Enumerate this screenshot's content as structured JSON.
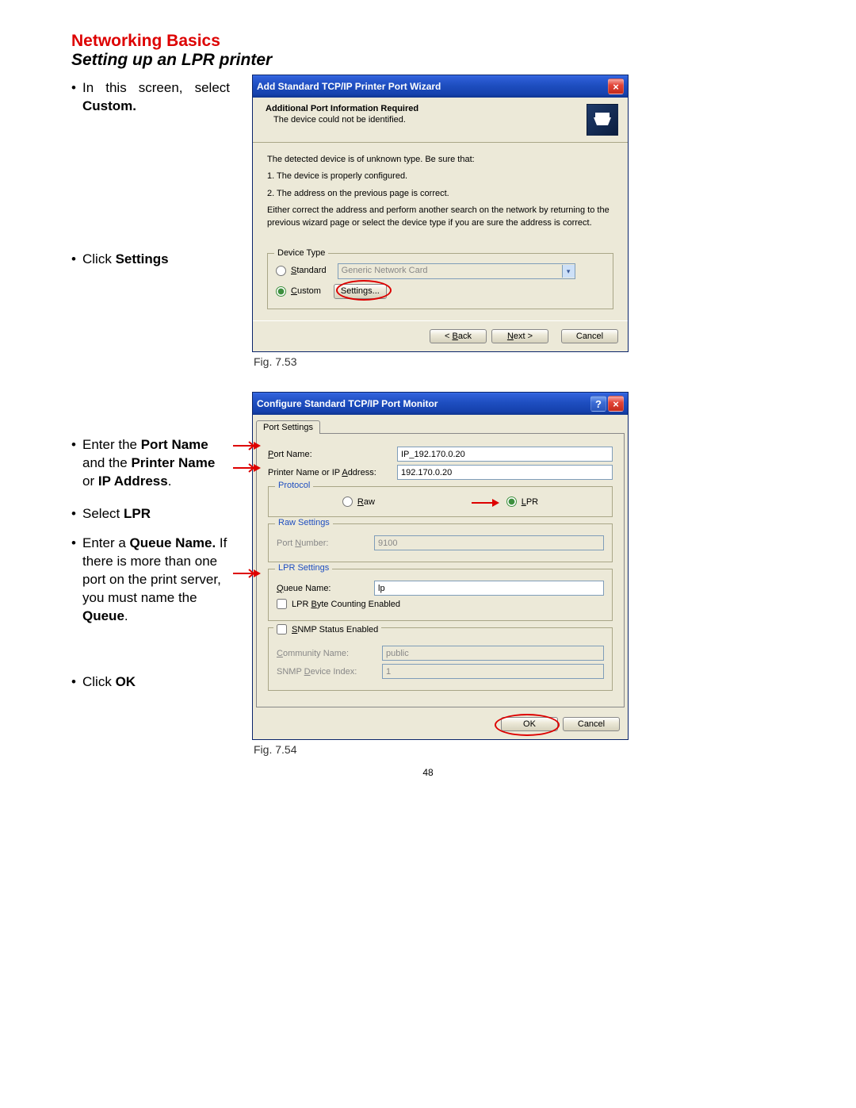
{
  "heading": {
    "title": "Networking Basics",
    "subtitle": "Setting up an LPR printer"
  },
  "instructions": {
    "step1_prefix": "In this screen, select ",
    "step1_bold": "Custom.",
    "step2_prefix": "Click ",
    "step2_bold": "Settings",
    "step3_a": "Enter the ",
    "step3_b1": "Port Name",
    "step3_c": " and the ",
    "step3_b2": "Printer Name",
    "step3_d": " or ",
    "step3_b3": "IP Address",
    "step3_e": ".",
    "step4_prefix": "Select ",
    "step4_bold": "LPR",
    "step5_a": "Enter a ",
    "step5_b1": "Queue Name.",
    "step5_c": "  If there is more than one port on the print server, you must name the ",
    "step5_b2": "Queue",
    "step5_d": ".",
    "step6_prefix": "Click ",
    "step6_bold": "OK"
  },
  "fig1_caption": "Fig. 7.53",
  "fig2_caption": "Fig. 7.54",
  "page_number": "48",
  "dialog1": {
    "title": "Add Standard TCP/IP Printer Port Wizard",
    "header_bold": "Additional Port Information Required",
    "header_sub": "The device could not be identified.",
    "body_line1": "The detected device is of unknown type.  Be sure that:",
    "body_line2": "1.  The device is properly configured.",
    "body_line3": "2.  The address on the previous page is correct.",
    "body_line4": "Either correct the address and perform another search on the network by returning to the previous wizard page or select the device type if you are sure the address is correct.",
    "fieldset_label": "Device Type",
    "radio_standard": "Standard",
    "select_value": "Generic Network Card",
    "radio_custom": "Custom",
    "settings_btn": "Settings...",
    "back_btn": "< Back",
    "next_btn": "Next >",
    "cancel_btn": "Cancel"
  },
  "dialog2": {
    "title": "Configure Standard TCP/IP Port Monitor",
    "tab": "Port Settings",
    "port_name_label": "Port Name:",
    "port_name_value": "IP_192.170.0.20",
    "printer_ip_label": "Printer Name or IP Address:",
    "printer_ip_value": "192.170.0.20",
    "protocol_legend": "Protocol",
    "radio_raw": "Raw",
    "radio_lpr": "LPR",
    "raw_settings_legend": "Raw Settings",
    "port_number_label": "Port Number:",
    "port_number_value": "9100",
    "lpr_settings_legend": "LPR Settings",
    "queue_name_label": "Queue Name:",
    "queue_name_value": "lp",
    "lpr_byte_label": "LPR Byte Counting Enabled",
    "snmp_enabled_label": "SNMP Status Enabled",
    "community_label": "Community Name:",
    "community_value": "public",
    "snmp_index_label": "SNMP Device Index:",
    "snmp_index_value": "1",
    "ok_btn": "OK",
    "cancel_btn": "Cancel"
  }
}
